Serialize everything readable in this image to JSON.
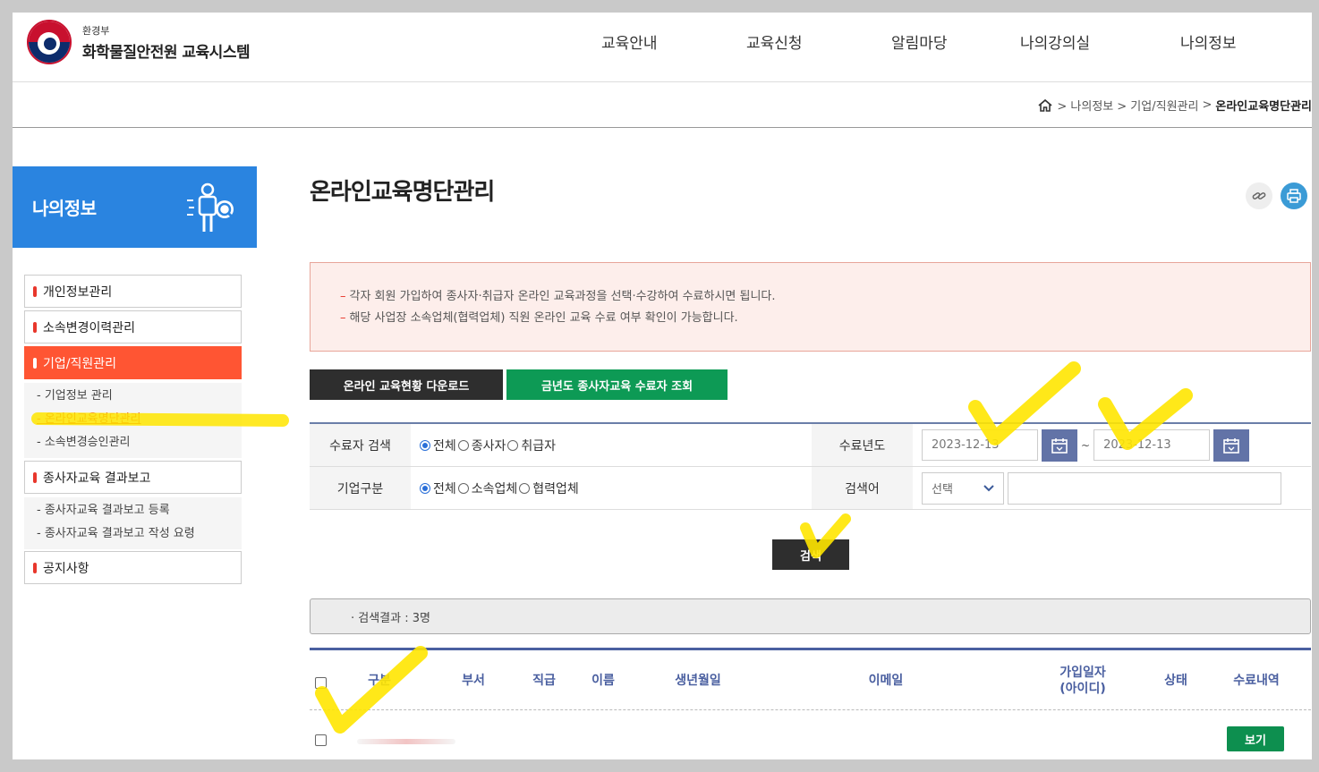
{
  "header": {
    "logo_sub": "환경부",
    "logo_main": "화학물질안전원 교육시스템",
    "nav": [
      "교육안내",
      "교육신청",
      "알림마당",
      "나의강의실",
      "나의정보"
    ]
  },
  "breadcrumb": {
    "items": [
      "> 나의정보",
      "> 기업/직원관리",
      ">"
    ],
    "current": "온라인교육명단관리"
  },
  "sidebar": {
    "title": "나의정보",
    "menus": [
      {
        "label": "개인정보관리"
      },
      {
        "label": "소속변경이력관리"
      },
      {
        "label": "기업/직원관리"
      },
      {
        "label": "종사자교육 결과보고"
      },
      {
        "label": "공지사항"
      }
    ],
    "sub_company": [
      "- 기업정보 관리",
      "- 온라인교육명단관리",
      "- 소속변경승인관리"
    ],
    "sub_report": [
      "- 종사자교육 결과보고 등록",
      "- 종사자교육 결과보고 작성 요령"
    ]
  },
  "main": {
    "title": "온라인교육명단관리",
    "notice": [
      "각자 회원 가입하여 종사자·취급자 온라인 교육과정을 선택·수강하여 수료하시면 됩니다.",
      "해당 사업장 소속업체(협력업체) 직원 온라인 교육 수료 여부 확인이 가능합니다."
    ],
    "notice_dash": "–",
    "btn_download": "온라인 교육현황 다운로드",
    "btn_lookup": "금년도 종사자교육 수료자 조회"
  },
  "search": {
    "label_completer": "수료자 검색",
    "completer_options": [
      "전체",
      "종사자",
      "취급자"
    ],
    "label_year": "수료년도",
    "date_from": "2023-12-13",
    "date_sep": "~",
    "date_to": "2023-12-13",
    "label_company": "기업구분",
    "company_options": [
      "전체",
      "소속업체",
      "협력업체"
    ],
    "label_keyword": "검색어",
    "keyword_select": "선택",
    "search_button": "검색"
  },
  "results": {
    "summary": "· 검색결과 : 3명"
  },
  "table": {
    "columns": [
      "구분",
      "부서",
      "직급",
      "이름",
      "생년월일",
      "이메일",
      "가입일자\n(아이디)",
      "상태",
      "수료내역"
    ],
    "col_join_line1": "가입일자",
    "col_join_line2": "(아이디)",
    "view_button": "보기"
  },
  "colors": {
    "accent_blue": "#2a84e0",
    "active_red": "#ff5533",
    "green": "#0d8f4f",
    "dark": "#2e2e2e",
    "highlight": "#ffe600"
  }
}
